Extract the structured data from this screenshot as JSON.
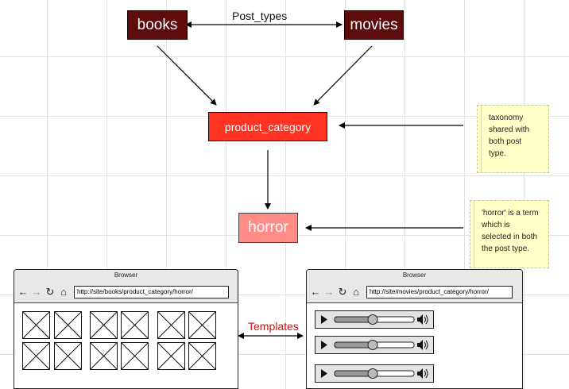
{
  "nodes": {
    "books": "books",
    "movies": "movies",
    "category": "product_category",
    "term": "horror"
  },
  "labels": {
    "post_types": "Post_types",
    "templates": "Templates"
  },
  "notes": {
    "taxonomy": "taxonomy shared with both post type.",
    "horror": "'horror' is a term which is selected in both the post type."
  },
  "browsers": {
    "left": {
      "title": "Browser",
      "url": "http://site/books/product_category/horror/"
    },
    "right": {
      "title": "Browser",
      "url": "http://site/movies/product_category/horror/"
    }
  },
  "colors": {
    "post_type": "#5e0b0b",
    "category": "#ff3322",
    "term": "#ff8c86",
    "templates_label": "#cc1111",
    "note": "#ffffc8"
  },
  "icons": {
    "back": "arrow-left-icon",
    "forward": "arrow-right-icon",
    "reload": "reload-icon",
    "home": "home-icon",
    "placeholder": "image-placeholder-icon",
    "play": "play-icon",
    "volume": "volume-icon"
  }
}
